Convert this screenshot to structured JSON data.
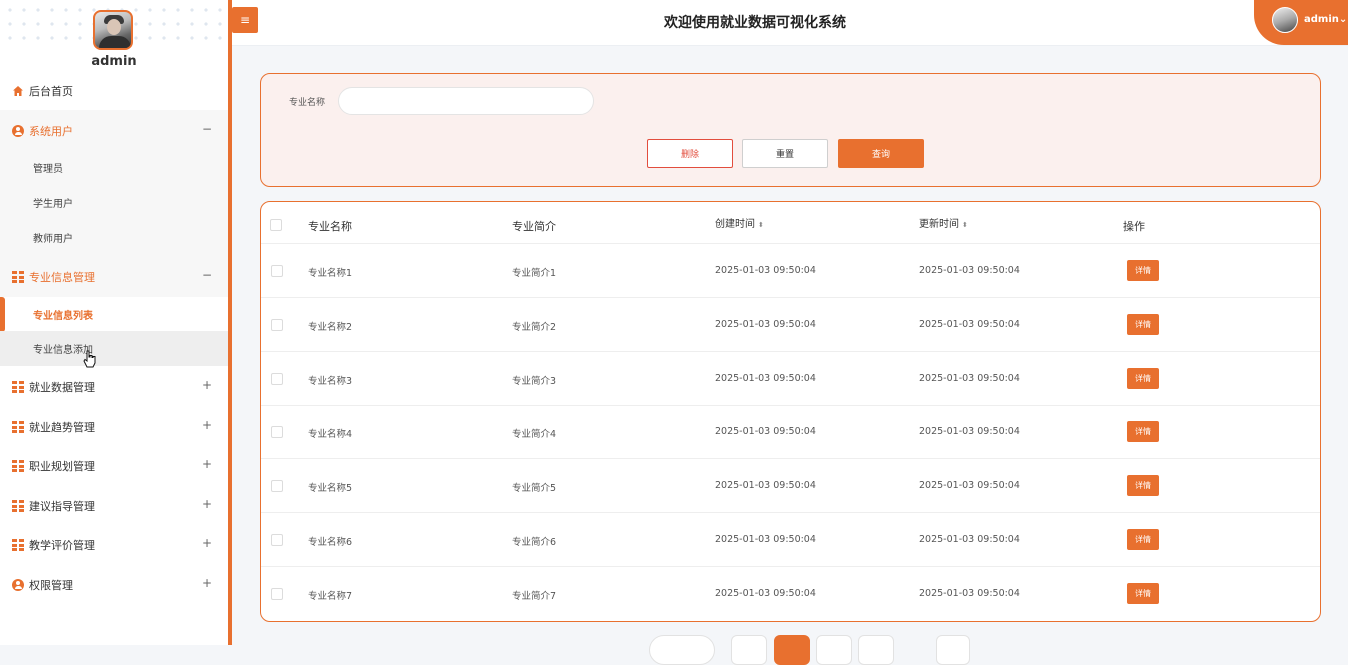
{
  "header": {
    "title": "欢迎使用就业数据可视化系统",
    "user": "admin",
    "user_caret": "⌄",
    "menu_toggle_glyph": "≡"
  },
  "sidebar": {
    "admin_name": "admin",
    "items": [
      {
        "label": "后台首页",
        "icon": "home-icon"
      },
      {
        "label": "系统用户",
        "icon": "user-icon",
        "toggle": "−",
        "children": [
          "管理员",
          "学生用户",
          "教师用户"
        ]
      },
      {
        "label": "专业信息管理",
        "icon": "grid-icon",
        "toggle": "−",
        "children": [
          "专业信息列表",
          "专业信息添加"
        ]
      },
      {
        "label": "就业数据管理",
        "icon": "grid-icon",
        "toggle": "+"
      },
      {
        "label": "就业趋势管理",
        "icon": "grid-icon",
        "toggle": "+"
      },
      {
        "label": "职业规划管理",
        "icon": "grid-icon",
        "toggle": "+"
      },
      {
        "label": "建议指导管理",
        "icon": "grid-icon",
        "toggle": "+"
      },
      {
        "label": "教学评价管理",
        "icon": "grid-icon",
        "toggle": "+"
      },
      {
        "label": "权限管理",
        "icon": "user-icon",
        "toggle": "+"
      }
    ]
  },
  "search": {
    "label": "专业名称",
    "value": "",
    "delete_label": "删除",
    "reset_label": "重置",
    "search_label": "查询"
  },
  "table": {
    "columns": [
      "专业名称",
      "专业简介",
      "创建时间",
      "更新时间",
      "操作"
    ],
    "sort_glyph": "⬍",
    "action_label": "详情",
    "rows": [
      {
        "name": "专业名称1",
        "intro": "专业简介1",
        "created": "2025-01-03 09:50:04",
        "updated": "2025-01-03 09:50:04"
      },
      {
        "name": "专业名称2",
        "intro": "专业简介2",
        "created": "2025-01-03 09:50:04",
        "updated": "2025-01-03 09:50:04"
      },
      {
        "name": "专业名称3",
        "intro": "专业简介3",
        "created": "2025-01-03 09:50:04",
        "updated": "2025-01-03 09:50:04"
      },
      {
        "name": "专业名称4",
        "intro": "专业简介4",
        "created": "2025-01-03 09:50:04",
        "updated": "2025-01-03 09:50:04"
      },
      {
        "name": "专业名称5",
        "intro": "专业简介5",
        "created": "2025-01-03 09:50:04",
        "updated": "2025-01-03 09:50:04"
      },
      {
        "name": "专业名称6",
        "intro": "专业简介6",
        "created": "2025-01-03 09:50:04",
        "updated": "2025-01-03 09:50:04"
      },
      {
        "name": "专业名称7",
        "intro": "专业简介7",
        "created": "2025-01-03 09:50:04",
        "updated": "2025-01-03 09:50:04"
      }
    ]
  },
  "colors": {
    "accent": "#e8702f",
    "danger": "#e24d3d",
    "panel_bg": "#fbf0ee"
  }
}
